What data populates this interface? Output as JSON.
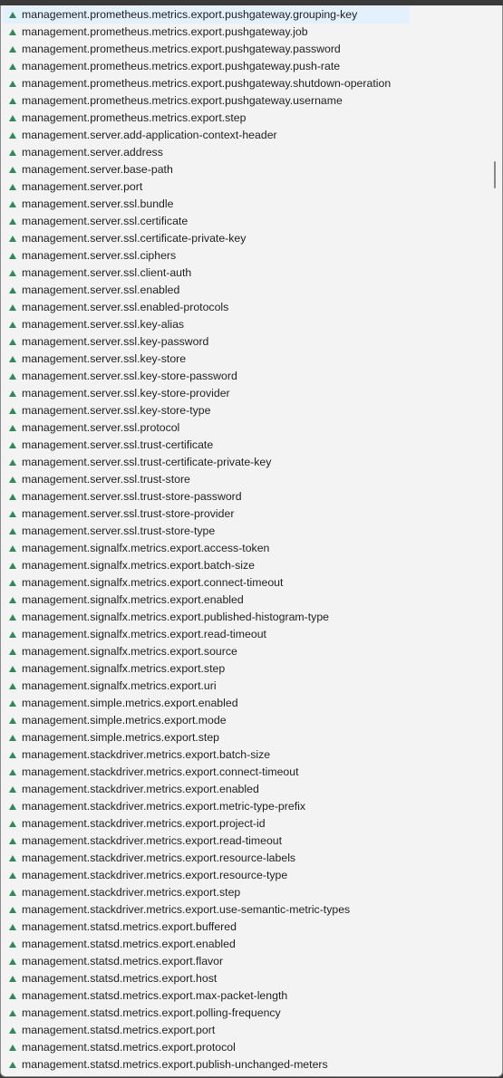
{
  "selected_index": 0,
  "item_icon": "property-triangle-icon",
  "icon_color": "#2e8b57",
  "items": [
    "management.prometheus.metrics.export.pushgateway.grouping-key",
    "management.prometheus.metrics.export.pushgateway.job",
    "management.prometheus.metrics.export.pushgateway.password",
    "management.prometheus.metrics.export.pushgateway.push-rate",
    "management.prometheus.metrics.export.pushgateway.shutdown-operation",
    "management.prometheus.metrics.export.pushgateway.username",
    "management.prometheus.metrics.export.step",
    "management.server.add-application-context-header",
    "management.server.address",
    "management.server.base-path",
    "management.server.port",
    "management.server.ssl.bundle",
    "management.server.ssl.certificate",
    "management.server.ssl.certificate-private-key",
    "management.server.ssl.ciphers",
    "management.server.ssl.client-auth",
    "management.server.ssl.enabled",
    "management.server.ssl.enabled-protocols",
    "management.server.ssl.key-alias",
    "management.server.ssl.key-password",
    "management.server.ssl.key-store",
    "management.server.ssl.key-store-password",
    "management.server.ssl.key-store-provider",
    "management.server.ssl.key-store-type",
    "management.server.ssl.protocol",
    "management.server.ssl.trust-certificate",
    "management.server.ssl.trust-certificate-private-key",
    "management.server.ssl.trust-store",
    "management.server.ssl.trust-store-password",
    "management.server.ssl.trust-store-provider",
    "management.server.ssl.trust-store-type",
    "management.signalfx.metrics.export.access-token",
    "management.signalfx.metrics.export.batch-size",
    "management.signalfx.metrics.export.connect-timeout",
    "management.signalfx.metrics.export.enabled",
    "management.signalfx.metrics.export.published-histogram-type",
    "management.signalfx.metrics.export.read-timeout",
    "management.signalfx.metrics.export.source",
    "management.signalfx.metrics.export.step",
    "management.signalfx.metrics.export.uri",
    "management.simple.metrics.export.enabled",
    "management.simple.metrics.export.mode",
    "management.simple.metrics.export.step",
    "management.stackdriver.metrics.export.batch-size",
    "management.stackdriver.metrics.export.connect-timeout",
    "management.stackdriver.metrics.export.enabled",
    "management.stackdriver.metrics.export.metric-type-prefix",
    "management.stackdriver.metrics.export.project-id",
    "management.stackdriver.metrics.export.read-timeout",
    "management.stackdriver.metrics.export.resource-labels",
    "management.stackdriver.metrics.export.resource-type",
    "management.stackdriver.metrics.export.step",
    "management.stackdriver.metrics.export.use-semantic-metric-types",
    "management.statsd.metrics.export.buffered",
    "management.statsd.metrics.export.enabled",
    "management.statsd.metrics.export.flavor",
    "management.statsd.metrics.export.host",
    "management.statsd.metrics.export.max-packet-length",
    "management.statsd.metrics.export.polling-frequency",
    "management.statsd.metrics.export.port",
    "management.statsd.metrics.export.protocol",
    "management.statsd.metrics.export.publish-unchanged-meters"
  ]
}
